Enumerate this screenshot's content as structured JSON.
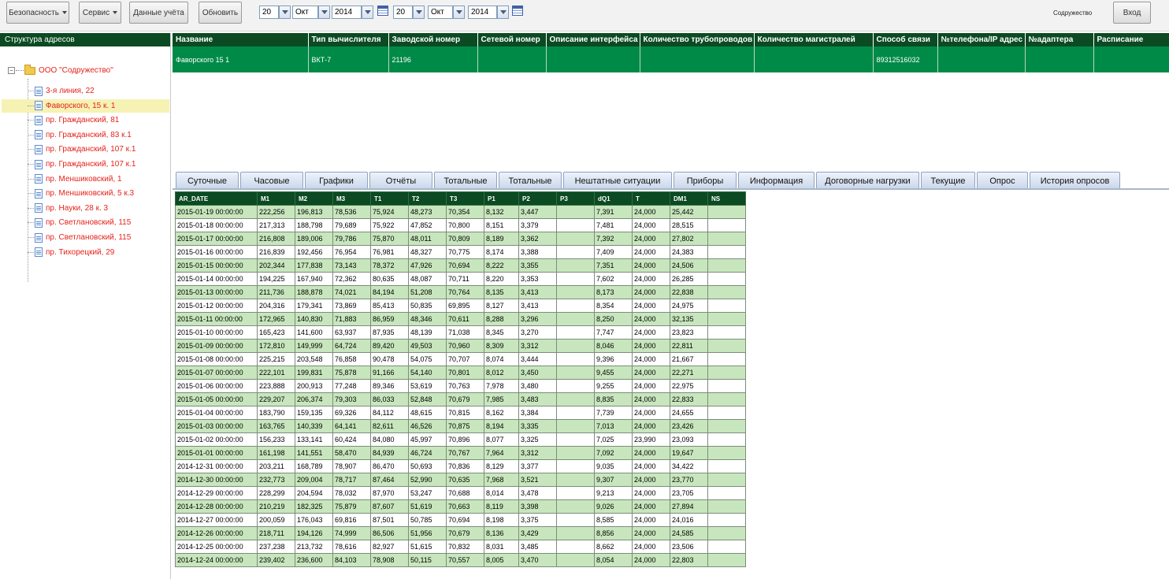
{
  "toolbar": {
    "security": "Безопасность",
    "service": "Сервис",
    "account_data": "Данные учёта",
    "refresh": "Обновить",
    "from_day": "20",
    "from_month": "Окт",
    "from_year": "2014",
    "to_day": "20",
    "to_month": "Окт",
    "to_year": "2014",
    "user": "Содружество",
    "login": "Вход"
  },
  "sidebar": {
    "header": "Структура адресов",
    "root": "ООО \"Содружество\"",
    "items": [
      "3-я линия, 22",
      "Фаворского, 15 к. 1",
      "пр. Гражданский, 81",
      "пр. Гражданский, 83 к.1",
      "пр. Гражданский, 107 к.1",
      "пр. Гражданский, 107 к.1",
      "пр. Меншиковский, 1",
      "пр. Меншиковский, 5 к.3",
      "пр. Науки, 28 к. 3",
      "пр. Светлановский, 115",
      "пр. Светлановский, 115",
      "пр. Тихорецкий, 29"
    ],
    "selected_index": 1
  },
  "meta": {
    "headers": [
      "Название",
      "Тип вычислителя",
      "Заводской номер",
      "Сетевой номер",
      "Описание интерфейса",
      "Количество трубопроводов",
      "Количество магистралей",
      "Способ связи",
      "№телефона/IP адрес",
      "№адаптера",
      "Расписание"
    ],
    "row": [
      "Фаворского 15 1",
      "ВКТ-7",
      "21196",
      "",
      "",
      "",
      "",
      "89312516032",
      "",
      "",
      ""
    ]
  },
  "tabs": [
    "Суточные",
    "Часовые",
    "Графики",
    "Отчёты",
    "Тотальные",
    "Тотальные",
    "Нештатные ситуации",
    "Приборы",
    "Информация",
    "Договорные нагрузки",
    "Текущие",
    "Опрос",
    "История опросов"
  ],
  "grid": {
    "headers": [
      "AR_DATE",
      "M1",
      "M2",
      "M3",
      "T1",
      "T2",
      "T3",
      "P1",
      "P2",
      "P3",
      "dQ1",
      "T",
      "DM1",
      "NS"
    ],
    "rows": [
      [
        "2015-01-19 00:00:00",
        "222,256",
        "196,813",
        "78,536",
        "75,924",
        "48,273",
        "70,354",
        "8,132",
        "3,447",
        "",
        "7,391",
        "24,000",
        "25,442",
        ""
      ],
      [
        "2015-01-18 00:00:00",
        "217,313",
        "188,798",
        "79,689",
        "75,922",
        "47,852",
        "70,800",
        "8,151",
        "3,379",
        "",
        "7,481",
        "24,000",
        "28,515",
        ""
      ],
      [
        "2015-01-17 00:00:00",
        "216,808",
        "189,006",
        "79,786",
        "75,870",
        "48,011",
        "70,809",
        "8,189",
        "3,362",
        "",
        "7,392",
        "24,000",
        "27,802",
        ""
      ],
      [
        "2015-01-16 00:00:00",
        "216,839",
        "192,456",
        "76,954",
        "76,981",
        "48,327",
        "70,775",
        "8,174",
        "3,388",
        "",
        "7,409",
        "24,000",
        "24,383",
        ""
      ],
      [
        "2015-01-15 00:00:00",
        "202,344",
        "177,838",
        "73,143",
        "78,372",
        "47,926",
        "70,694",
        "8,222",
        "3,355",
        "",
        "7,351",
        "24,000",
        "24,506",
        ""
      ],
      [
        "2015-01-14 00:00:00",
        "194,225",
        "167,940",
        "72,362",
        "80,635",
        "48,087",
        "70,711",
        "8,220",
        "3,353",
        "",
        "7,602",
        "24,000",
        "26,285",
        ""
      ],
      [
        "2015-01-13 00:00:00",
        "211,736",
        "188,878",
        "74,021",
        "84,194",
        "51,208",
        "70,764",
        "8,135",
        "3,413",
        "",
        "8,173",
        "24,000",
        "22,838",
        ""
      ],
      [
        "2015-01-12 00:00:00",
        "204,316",
        "179,341",
        "73,869",
        "85,413",
        "50,835",
        "69,895",
        "8,127",
        "3,413",
        "",
        "8,354",
        "24,000",
        "24,975",
        ""
      ],
      [
        "2015-01-11 00:00:00",
        "172,965",
        "140,830",
        "71,883",
        "86,959",
        "48,346",
        "70,611",
        "8,288",
        "3,296",
        "",
        "8,250",
        "24,000",
        "32,135",
        ""
      ],
      [
        "2015-01-10 00:00:00",
        "165,423",
        "141,600",
        "63,937",
        "87,935",
        "48,139",
        "71,038",
        "8,345",
        "3,270",
        "",
        "7,747",
        "24,000",
        "23,823",
        ""
      ],
      [
        "2015-01-09 00:00:00",
        "172,810",
        "149,999",
        "64,724",
        "89,420",
        "49,503",
        "70,960",
        "8,309",
        "3,312",
        "",
        "8,046",
        "24,000",
        "22,811",
        ""
      ],
      [
        "2015-01-08 00:00:00",
        "225,215",
        "203,548",
        "76,858",
        "90,478",
        "54,075",
        "70,707",
        "8,074",
        "3,444",
        "",
        "9,396",
        "24,000",
        "21,667",
        ""
      ],
      [
        "2015-01-07 00:00:00",
        "222,101",
        "199,831",
        "75,878",
        "91,166",
        "54,140",
        "70,801",
        "8,012",
        "3,450",
        "",
        "9,455",
        "24,000",
        "22,271",
        ""
      ],
      [
        "2015-01-06 00:00:00",
        "223,888",
        "200,913",
        "77,248",
        "89,346",
        "53,619",
        "70,763",
        "7,978",
        "3,480",
        "",
        "9,255",
        "24,000",
        "22,975",
        ""
      ],
      [
        "2015-01-05 00:00:00",
        "229,207",
        "206,374",
        "79,303",
        "86,033",
        "52,848",
        "70,679",
        "7,985",
        "3,483",
        "",
        "8,835",
        "24,000",
        "22,833",
        ""
      ],
      [
        "2015-01-04 00:00:00",
        "183,790",
        "159,135",
        "69,326",
        "84,112",
        "48,615",
        "70,815",
        "8,162",
        "3,384",
        "",
        "7,739",
        "24,000",
        "24,655",
        ""
      ],
      [
        "2015-01-03 00:00:00",
        "163,765",
        "140,339",
        "64,141",
        "82,611",
        "46,526",
        "70,875",
        "8,194",
        "3,335",
        "",
        "7,013",
        "24,000",
        "23,426",
        ""
      ],
      [
        "2015-01-02 00:00:00",
        "156,233",
        "133,141",
        "60,424",
        "84,080",
        "45,997",
        "70,896",
        "8,077",
        "3,325",
        "",
        "7,025",
        "23,990",
        "23,093",
        ""
      ],
      [
        "2015-01-01 00:00:00",
        "161,198",
        "141,551",
        "58,470",
        "84,939",
        "46,724",
        "70,767",
        "7,964",
        "3,312",
        "",
        "7,092",
        "24,000",
        "19,647",
        ""
      ],
      [
        "2014-12-31 00:00:00",
        "203,211",
        "168,789",
        "78,907",
        "86,470",
        "50,693",
        "70,836",
        "8,129",
        "3,377",
        "",
        "9,035",
        "24,000",
        "34,422",
        ""
      ],
      [
        "2014-12-30 00:00:00",
        "232,773",
        "209,004",
        "78,717",
        "87,464",
        "52,990",
        "70,635",
        "7,968",
        "3,521",
        "",
        "9,307",
        "24,000",
        "23,770",
        ""
      ],
      [
        "2014-12-29 00:00:00",
        "228,299",
        "204,594",
        "78,032",
        "87,970",
        "53,247",
        "70,688",
        "8,014",
        "3,478",
        "",
        "9,213",
        "24,000",
        "23,705",
        ""
      ],
      [
        "2014-12-28 00:00:00",
        "210,219",
        "182,325",
        "75,879",
        "87,607",
        "51,619",
        "70,663",
        "8,119",
        "3,398",
        "",
        "9,026",
        "24,000",
        "27,894",
        ""
      ],
      [
        "2014-12-27 00:00:00",
        "200,059",
        "176,043",
        "69,816",
        "87,501",
        "50,785",
        "70,694",
        "8,198",
        "3,375",
        "",
        "8,585",
        "24,000",
        "24,016",
        ""
      ],
      [
        "2014-12-26 00:00:00",
        "218,711",
        "194,126",
        "74,999",
        "86,506",
        "51,956",
        "70,679",
        "8,136",
        "3,429",
        "",
        "8,856",
        "24,000",
        "24,585",
        ""
      ],
      [
        "2014-12-25 00:00:00",
        "237,238",
        "213,732",
        "78,616",
        "82,927",
        "51,615",
        "70,832",
        "8,031",
        "3,485",
        "",
        "8,662",
        "24,000",
        "23,506",
        ""
      ],
      [
        "2014-12-24 00:00:00",
        "239,402",
        "236,600",
        "84,103",
        "78,908",
        "50,115",
        "70,557",
        "8,005",
        "3,470",
        "",
        "8,054",
        "24,000",
        "22,803",
        ""
      ]
    ]
  }
}
